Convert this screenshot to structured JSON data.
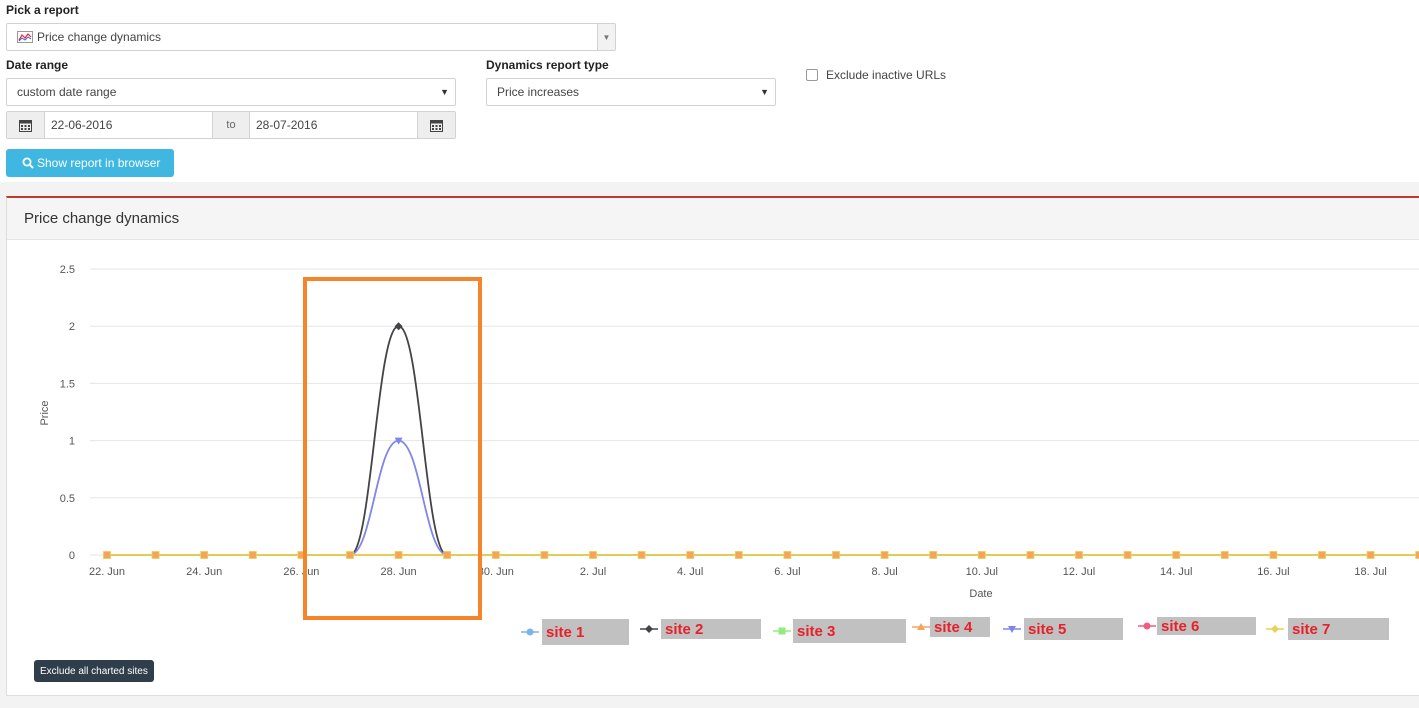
{
  "form": {
    "report_label": "Pick a report",
    "report_value": "Price change dynamics",
    "date_range_label": "Date range",
    "date_range_value": "custom date range",
    "dynamics_label": "Dynamics report type",
    "dynamics_value": "Price increases",
    "exclude_inactive_label": "Exclude inactive URLs",
    "date_from": "22-06-2016",
    "date_to_sep": "to",
    "date_to": "28-07-2016",
    "show_button": "Show report in browser"
  },
  "panel": {
    "title": "Price change dynamics",
    "exclude_button": "Exclude all charted sites"
  },
  "colors": {
    "accent": "#3fb7e0",
    "panel_border": "#c0392b",
    "highlight": "#f5842a",
    "legend_text": "#e8202a"
  },
  "chart_data": {
    "type": "line",
    "ylabel": "Price",
    "xlabel": "Date",
    "ylim": [
      0,
      2.5
    ],
    "yticks": [
      "0",
      "0.5",
      "1",
      "1.5",
      "2",
      "2.5"
    ],
    "xticks": [
      "22. Jun",
      "24. Jun",
      "26. Jun",
      "28. Jun",
      "30. Jun",
      "2. Jul",
      "4. Jul",
      "6. Jul",
      "8. Jul",
      "10. Jul",
      "12. Jul",
      "14. Jul",
      "16. Jul",
      "18. Jul"
    ],
    "x": [
      "22. Jun",
      "23. Jun",
      "24. Jun",
      "25. Jun",
      "26. Jun",
      "27. Jun",
      "28. Jun",
      "29. Jun",
      "30. Jun",
      "1. Jul",
      "2. Jul",
      "3. Jul",
      "4. Jul",
      "5. Jul",
      "6. Jul",
      "7. Jul",
      "8. Jul",
      "9. Jul",
      "10. Jul",
      "11. Jul",
      "12. Jul",
      "13. Jul",
      "14. Jul",
      "15. Jul",
      "16. Jul",
      "17. Jul",
      "18. Jul",
      "19. Jul"
    ],
    "grid": true,
    "series": [
      {
        "name": "site 1",
        "color": "#7cb5ec",
        "values": [
          0,
          0,
          0,
          0,
          0,
          0,
          0,
          0,
          0,
          0,
          0,
          0,
          0,
          0,
          0,
          0,
          0,
          0,
          0,
          0,
          0,
          0,
          0,
          0,
          0,
          0,
          0,
          0
        ]
      },
      {
        "name": "site 2",
        "color": "#434348",
        "values": [
          0,
          0,
          0,
          0,
          0,
          0,
          2,
          0,
          0,
          0,
          0,
          0,
          0,
          0,
          0,
          0,
          0,
          0,
          0,
          0,
          0,
          0,
          0,
          0,
          0,
          0,
          0,
          0
        ]
      },
      {
        "name": "site 3",
        "color": "#90ed7d",
        "values": [
          0,
          0,
          0,
          0,
          0,
          0,
          0,
          0,
          0,
          0,
          0,
          0,
          0,
          0,
          0,
          0,
          0,
          0,
          0,
          0,
          0,
          0,
          0,
          0,
          0,
          0,
          0,
          0
        ]
      },
      {
        "name": "site 4",
        "color": "#f7a35c",
        "values": [
          0,
          0,
          0,
          0,
          0,
          0,
          0,
          0,
          0,
          0,
          0,
          0,
          0,
          0,
          0,
          0,
          0,
          0,
          0,
          0,
          0,
          0,
          0,
          0,
          0,
          0,
          0,
          0
        ]
      },
      {
        "name": "site 5",
        "color": "#8085e9",
        "values": [
          0,
          0,
          0,
          0,
          0,
          0,
          1,
          0,
          0,
          0,
          0,
          0,
          0,
          0,
          0,
          0,
          0,
          0,
          0,
          0,
          0,
          0,
          0,
          0,
          0,
          0,
          0,
          0
        ]
      },
      {
        "name": "site 6",
        "color": "#f15c80",
        "values": [
          0,
          0,
          0,
          0,
          0,
          0,
          0,
          0,
          0,
          0,
          0,
          0,
          0,
          0,
          0,
          0,
          0,
          0,
          0,
          0,
          0,
          0,
          0,
          0,
          0,
          0,
          0,
          0
        ]
      },
      {
        "name": "site 7",
        "color": "#e4d354",
        "values": [
          0,
          0,
          0,
          0,
          0,
          0,
          0,
          0,
          0,
          0,
          0,
          0,
          0,
          0,
          0,
          0,
          0,
          0,
          0,
          0,
          0,
          0,
          0,
          0,
          0,
          0,
          0,
          0
        ]
      }
    ]
  }
}
